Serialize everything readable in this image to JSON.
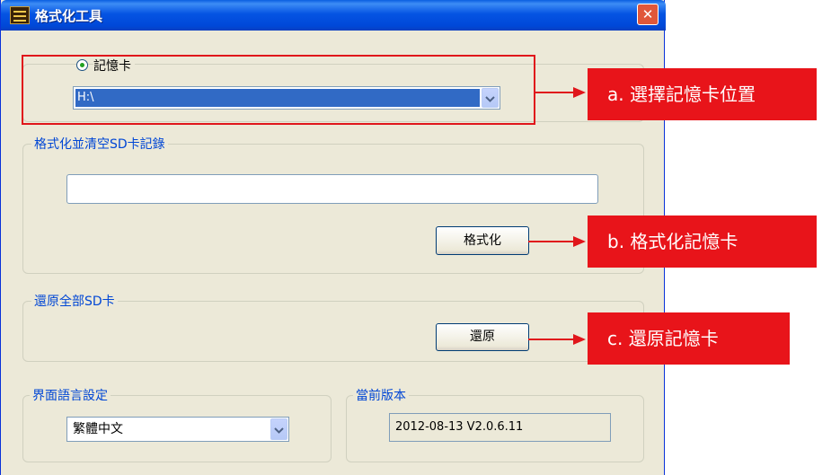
{
  "window": {
    "title": "格式化工具",
    "close_glyph": "✕"
  },
  "storage": {
    "radio_label": "記憶卡",
    "drive_value": "H:\\"
  },
  "format_group": {
    "legend": "格式化並清空SD卡記錄",
    "path_value": "",
    "button_label": "格式化"
  },
  "restore_group": {
    "legend": "還原全部SD卡",
    "button_label": "還原"
  },
  "language_group": {
    "legend": "界面語言設定",
    "selected": "繁體中文"
  },
  "version_group": {
    "legend": "當前版本",
    "value": "2012-08-13 V2.0.6.11"
  },
  "annotations": {
    "a": "a. 選擇記憶卡位置",
    "b": "b. 格式化記憶卡",
    "c": "c. 還原記憶卡"
  },
  "colors": {
    "annotation_red": "#e8141a",
    "titlebar_blue": "#0054e3",
    "selection_blue": "#316ac5"
  },
  "icons": {
    "app": "app-icon",
    "close": "close-icon",
    "dropdown": "chevron-down-icon",
    "radio": "radio-selected-icon"
  }
}
